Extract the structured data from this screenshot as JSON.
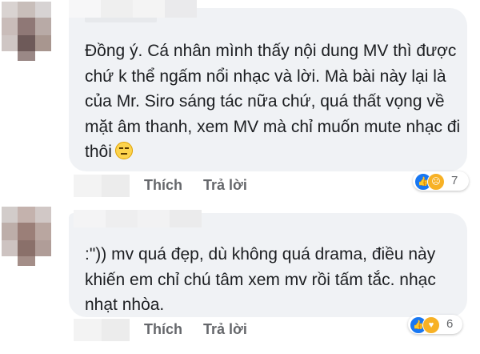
{
  "comments": [
    {
      "text": "Đồng ý. Cá nhân mình thấy nội dung MV thì được chứ k thể ngấm nổi nhạc và lời. Mà bài này lại là của Mr. Siro sáng tác nữa chứ, quá thất vọng về mặt âm thanh, xem MV mà chỉ muốn mute nhạc đi thôi",
      "emoji": "expressionless-face",
      "like_label": "Thích",
      "reply_label": "Trả lời",
      "reactions": [
        "like",
        "sad"
      ],
      "reaction_count": "7"
    },
    {
      "text": ":\")) mv quá đẹp, dù không quá drama, điều này khiến em chỉ chú tâm xem mv rồi tấm tắc. nhạc nhạt nhòa.",
      "emoji": "",
      "like_label": "Thích",
      "reply_label": "Trả lời",
      "reactions": [
        "like",
        "care"
      ],
      "reaction_count": "6"
    }
  ],
  "colors": {
    "bubble": "#f0f2f5",
    "text": "#1c1e21",
    "action": "#65676b",
    "like": "#1877f2",
    "sad": "#f7b125"
  }
}
